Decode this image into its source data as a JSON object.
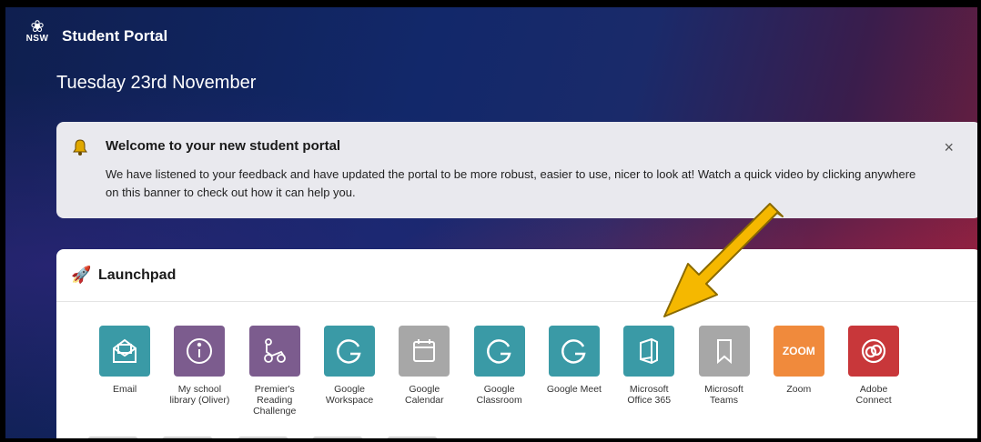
{
  "header": {
    "logo_text": "NSW",
    "brand": "Student Portal"
  },
  "date": "Tuesday 23rd November",
  "banner": {
    "title": "Welcome to your new student portal",
    "text": "We have listened to your feedback and have updated the portal to be more robust, easier to use, nicer to look at! Watch a quick video by clicking anywhere on this banner to check out how it can help you.",
    "close": "×"
  },
  "launchpad": {
    "title": "Launchpad",
    "apps": [
      {
        "label": "Email",
        "color": "#3a9aa6",
        "icon": "envelope-icon"
      },
      {
        "label": "My school library (Oliver)",
        "color": "#7c5c8e",
        "icon": "info-icon"
      },
      {
        "label": "Premier's Reading Challenge",
        "color": "#7c5c8e",
        "icon": "reading-icon"
      },
      {
        "label": "Google Workspace",
        "color": "#3a9aa6",
        "icon": "google-icon"
      },
      {
        "label": "Google Calendar",
        "color": "#a7a7a7",
        "icon": "calendar-icon"
      },
      {
        "label": "Google Classroom",
        "color": "#3a9aa6",
        "icon": "google-icon"
      },
      {
        "label": "Google Meet",
        "color": "#3a9aa6",
        "icon": "google-icon"
      },
      {
        "label": "Microsoft Office 365",
        "color": "#3a9aa6",
        "icon": "office-icon"
      },
      {
        "label": "Microsoft Teams",
        "color": "#a7a7a7",
        "icon": "bookmark-icon"
      },
      {
        "label": "Zoom",
        "color": "#f08a3c",
        "icon": "zoom-icon",
        "icon_text": "ZOOM"
      },
      {
        "label": "Adobe Connect",
        "color": "#c8373a",
        "icon": "adobe-connect-icon"
      }
    ]
  },
  "colors": {
    "arrow": "#f5b800",
    "accent": "#12286a"
  }
}
